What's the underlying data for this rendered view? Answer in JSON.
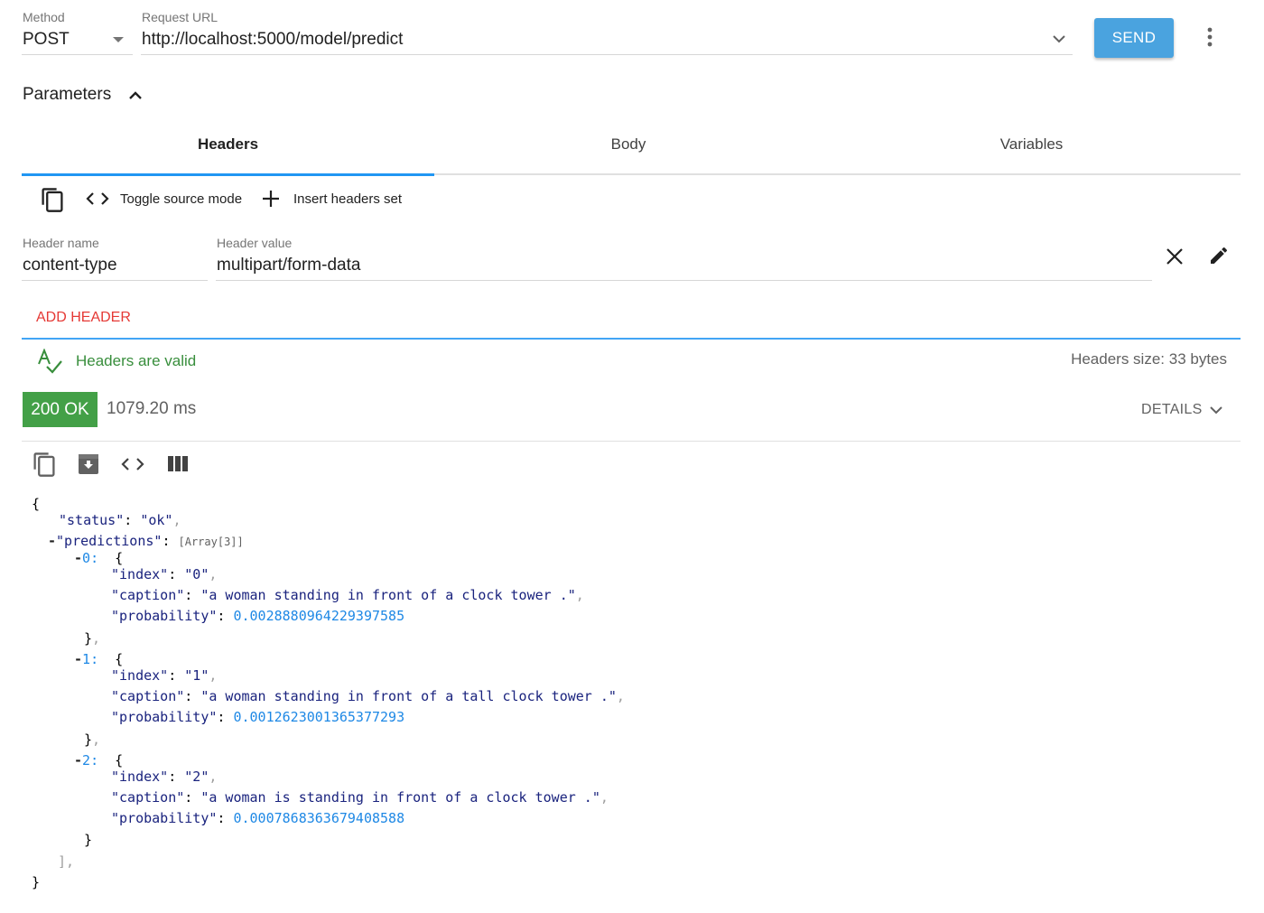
{
  "request": {
    "method_label": "Method",
    "method_value": "POST",
    "url_label": "Request URL",
    "url_value": "http://localhost:5000/model/predict",
    "send_label": "SEND"
  },
  "parameters": {
    "title": "Parameters",
    "tabs": [
      {
        "label": "Headers"
      },
      {
        "label": "Body"
      },
      {
        "label": "Variables"
      }
    ],
    "toolbar": {
      "toggle_source_label": "Toggle source mode",
      "insert_headers_label": "Insert headers set"
    },
    "header_row": {
      "name_label": "Header name",
      "name_value": "content-type",
      "value_label": "Header value",
      "value_value": "multipart/form-data"
    },
    "add_header_label": "ADD HEADER",
    "valid_text": "Headers are valid",
    "size_text": "Headers size: 33 bytes"
  },
  "response": {
    "status_badge": "200 OK",
    "time": "1079.20 ms",
    "details_label": "DETAILS",
    "body": {
      "status_key": "\"status\"",
      "status_value": "\"ok\"",
      "predictions_key": "\"predictions\"",
      "predictions_type": "Array[3]",
      "items": [
        {
          "index_label": "0",
          "index_key": "\"index\"",
          "index_value": "\"0\"",
          "caption_key": "\"caption\"",
          "caption_value": "\"a woman standing in front of a clock tower .\"",
          "probability_key": "\"probability\"",
          "probability_value": "0.0028880964229397585"
        },
        {
          "index_label": "1",
          "index_key": "\"index\"",
          "index_value": "\"1\"",
          "caption_key": "\"caption\"",
          "caption_value": "\"a woman standing in front of a tall clock tower .\"",
          "probability_key": "\"probability\"",
          "probability_value": "0.0012623001365377293"
        },
        {
          "index_label": "2",
          "index_key": "\"index\"",
          "index_value": "\"2\"",
          "caption_key": "\"caption\"",
          "caption_value": "\"a woman is standing in front of a clock tower .\"",
          "probability_key": "\"probability\"",
          "probability_value": "0.0007868363679408588"
        }
      ]
    }
  },
  "colors": {
    "accent": "#4aa3df",
    "tab_indicator": "#2196f3",
    "add_header": "#e53935",
    "valid": "#388e3c",
    "status_ok": "#43a047",
    "json_key": "#1a237e",
    "json_number": "#1e88e5"
  },
  "icons": {
    "method_dropdown": "triangle-down-icon",
    "url_dropdown": "chevron-down-icon",
    "more": "more-vert-icon",
    "collapse": "chevron-up-icon",
    "copy": "copy-icon",
    "code": "code-icon",
    "add": "plus-icon",
    "remove": "close-icon",
    "edit": "pencil-icon",
    "spellcheck": "spellcheck-icon",
    "save": "archive-icon",
    "columns": "view-column-icon"
  }
}
